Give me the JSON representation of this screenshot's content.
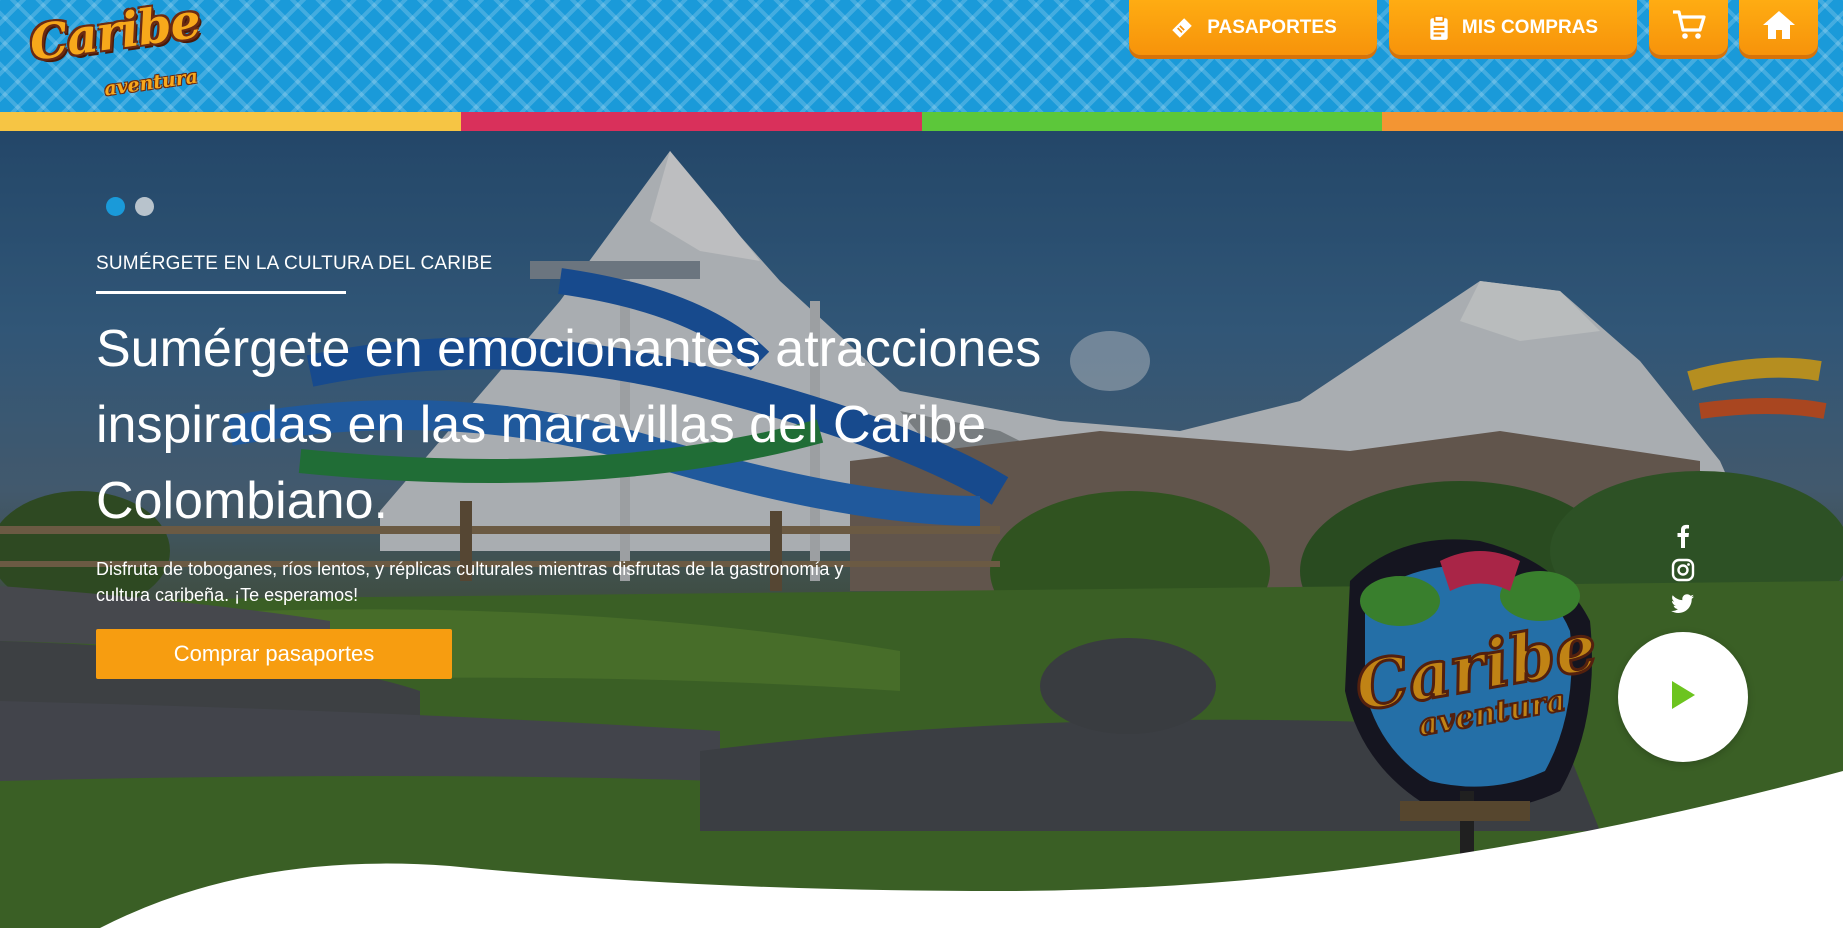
{
  "brand": {
    "logo_main": "Caribe",
    "logo_sub": "aventura"
  },
  "nav": {
    "pasaportes": "PASAPORTES",
    "mis_compras": "MIS COMPRAS",
    "cart_icon": "cart-icon",
    "home_icon": "home-icon"
  },
  "colors": {
    "header_blue": "#1a9ad9",
    "accent_orange": "#f79d10",
    "stripe_yellow": "#f6c544",
    "stripe_red": "#d9305b",
    "stripe_green": "#5cc73a",
    "stripe_orange": "#f39533",
    "play_green": "#6cc41f"
  },
  "hero": {
    "slides_total": 2,
    "active_slide": 1,
    "eyebrow": "SUMÉRGETE EN LA CULTURA DEL CARIBE",
    "headline_lines": [
      "Sumérgete en emocionantes atracciones",
      "inspiradas en las maravillas del Caribe",
      "Colombiano."
    ],
    "subtext_lines": [
      "Disfruta de toboganes, ríos lentos, y réplicas culturales mientras disfrutas de la gastronomía y",
      "cultura caribeña. ¡Te esperamos!"
    ],
    "cta": "Comprar pasaportes",
    "sign_main": "Caribe",
    "sign_sub": "aventura"
  },
  "social": [
    "facebook-icon",
    "instagram-icon",
    "twitter-icon"
  ],
  "video": {
    "icon": "play-icon"
  }
}
